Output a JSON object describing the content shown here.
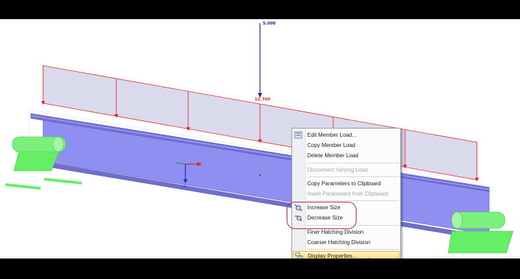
{
  "loads": {
    "point_load_value": "5.000",
    "distributed_load_value": "12.700"
  },
  "axes": {
    "x": "X",
    "z": "Z"
  },
  "context_menu": {
    "edit_member_load": "Edit Member Load...",
    "copy_member_load": "Copy Member Load",
    "delete_member_load": "Delete Member Load",
    "disconnect_varying_load": "Disconnect Varying Load",
    "copy_parameters": "Copy Parameters to Clipboard",
    "insert_parameters": "Insert Parameters from Clipboard",
    "increase_size": "Increase Size",
    "decrease_size": "Decrease Size",
    "finer_hatching": "Finer Hatching Division",
    "coarser_hatching": "Coarser Hatching Division",
    "display_properties": "Display Properties..."
  },
  "colors": {
    "beam_fill": "#8f8ff2",
    "load_fill": "#d3d3ea",
    "load_line": "#e32222",
    "point_load": "#2020a8",
    "support": "#66ee66",
    "highlight_ring": "#b5223a"
  },
  "icons": [
    "edit-load-icon",
    "increase-size-icon",
    "decrease-size-icon",
    "display-properties-icon",
    "mouse-pointer-icon"
  ]
}
